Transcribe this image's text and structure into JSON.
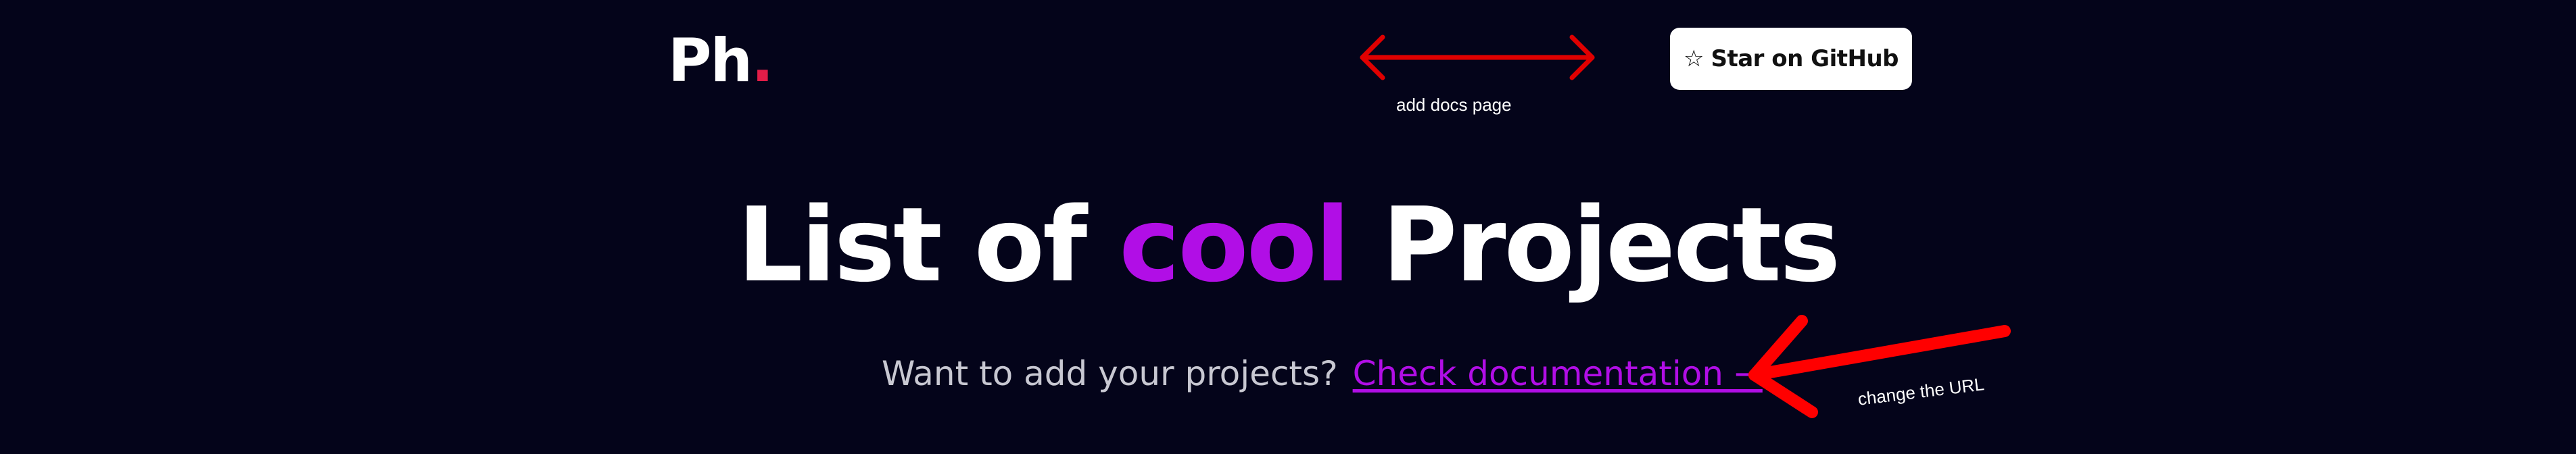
{
  "header": {
    "logo_text": "Ph",
    "logo_dot": ".",
    "github_button": {
      "icon": "star-outline-icon",
      "icon_glyph": "☆",
      "label": "Star on GitHub"
    }
  },
  "hero": {
    "title_before": "List of ",
    "title_highlight": "cool",
    "title_after": " Projects",
    "subtitle_question": "Want to add your projects?",
    "subtitle_link": "Check documentation →"
  },
  "annotations": {
    "top_arrow_note": "add docs page",
    "bottom_arrow_note": "change the URL",
    "arrow_color": "#e00000"
  },
  "colors": {
    "background": "#04041a",
    "accent": "#b10ee6",
    "logo_dot": "#e11d48",
    "button_bg": "#ffffff"
  }
}
